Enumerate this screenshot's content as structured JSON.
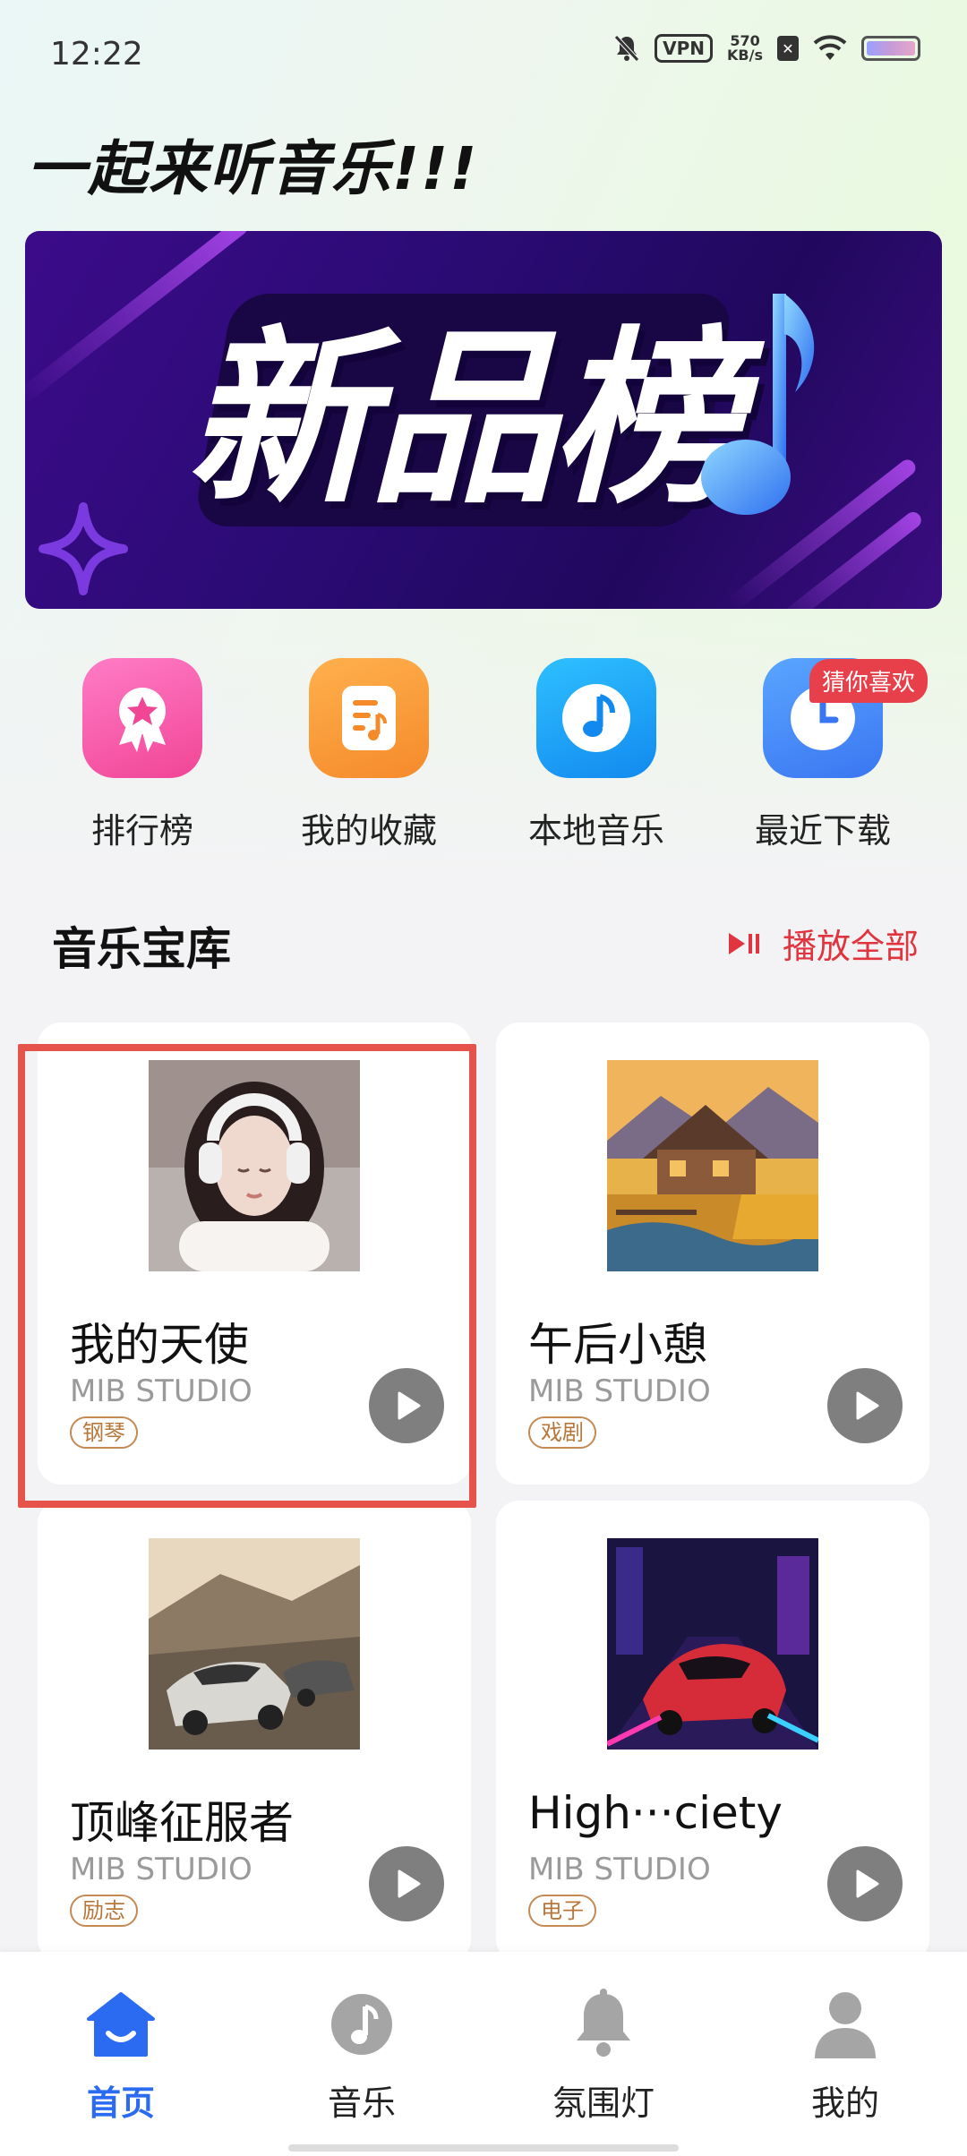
{
  "status_bar": {
    "time": "12:22",
    "vpn": "VPN",
    "speed_value": "570",
    "speed_unit": "KB/s",
    "icons": [
      "bell-muted-icon",
      "vpn-icon",
      "sim-x-icon",
      "wifi-icon",
      "battery-icon"
    ]
  },
  "header": {
    "headline": "一起来听音乐!!!"
  },
  "banner": {
    "text": "新品榜",
    "icon": "music-note-icon"
  },
  "quick_actions": [
    {
      "label": "排行榜",
      "icon": "ranking-ribbon-icon",
      "color": "#f25aa9"
    },
    {
      "label": "我的收藏",
      "icon": "music-sheet-icon",
      "color": "#f7963b"
    },
    {
      "label": "本地音乐",
      "icon": "music-note-circle-icon",
      "color": "#1f9cf5"
    },
    {
      "label": "最近下载",
      "icon": "clock-icon",
      "color": "#3f84f6",
      "badge": "猜你喜欢"
    }
  ],
  "library": {
    "title": "音乐宝库",
    "play_all": "播放全部",
    "songs": [
      {
        "title": "我的天使",
        "artist": "MIB STUDIO",
        "tag": "钢琴",
        "cover": "girl-headphones",
        "highlighted": true
      },
      {
        "title": "午后小憩",
        "artist": "MIB STUDIO",
        "tag": "戏剧",
        "cover": "farmhouse-landscape"
      },
      {
        "title": "顶峰征服者",
        "artist": "MIB STUDIO",
        "tag": "励志",
        "cover": "sports-cars-mountain"
      },
      {
        "title": "High···ciety",
        "artist": "MIB STUDIO",
        "tag": "电子",
        "cover": "neon-sports-car"
      }
    ]
  },
  "bottom_nav": [
    {
      "label": "首页",
      "icon": "home-icon",
      "active": true,
      "active_color": "#2a6bf2"
    },
    {
      "label": "音乐",
      "icon": "music-disc-icon"
    },
    {
      "label": "氛围灯",
      "icon": "bell-icon"
    },
    {
      "label": "我的",
      "icon": "user-icon"
    }
  ]
}
